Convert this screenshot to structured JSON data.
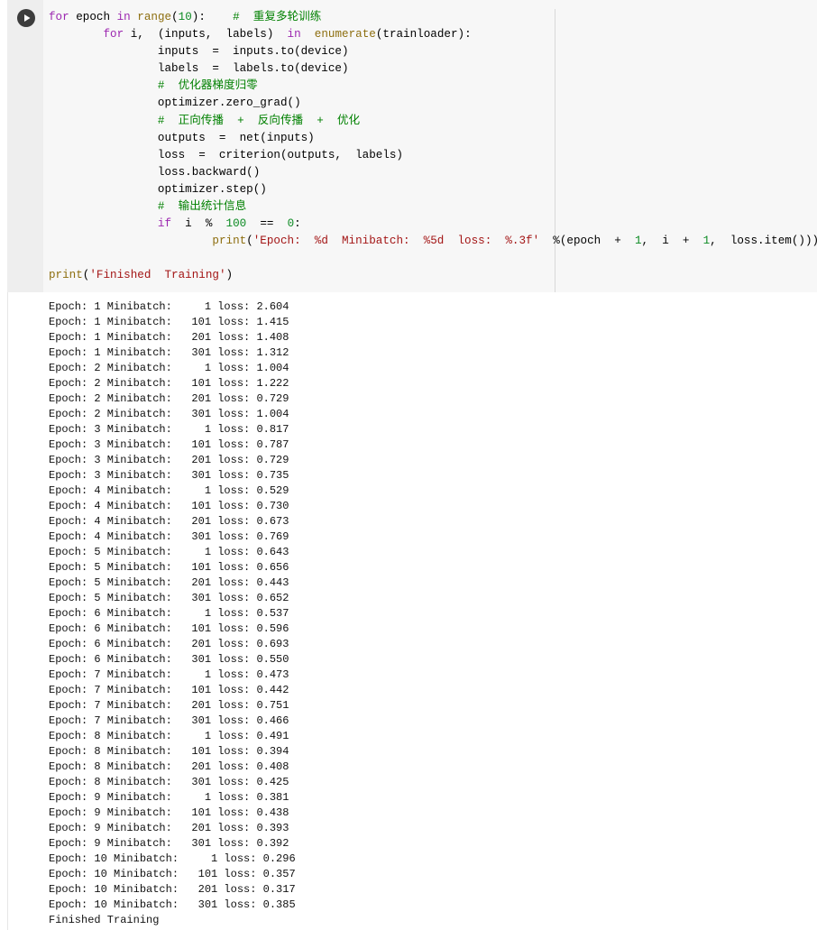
{
  "code_lines": [
    [
      {
        "t": "for",
        "c": "kw"
      },
      {
        "t": " epoch "
      },
      {
        "t": "in",
        "c": "kw"
      },
      {
        "t": " "
      },
      {
        "t": "range",
        "c": "fn"
      },
      {
        "t": "("
      },
      {
        "t": "10",
        "c": "num"
      },
      {
        "t": "):    "
      },
      {
        "t": "#  重复多轮训练",
        "c": "cm"
      }
    ],
    [
      {
        "t": "        "
      },
      {
        "t": "for",
        "c": "kw"
      },
      {
        "t": " i,  (inputs,  labels)  "
      },
      {
        "t": "in",
        "c": "kw"
      },
      {
        "t": "  "
      },
      {
        "t": "enumerate",
        "c": "fn"
      },
      {
        "t": "(trainloader):"
      }
    ],
    [
      {
        "t": "                inputs  =  inputs.to(device)"
      }
    ],
    [
      {
        "t": "                labels  =  labels.to(device)"
      }
    ],
    [
      {
        "t": "                "
      },
      {
        "t": "#  优化器梯度归零",
        "c": "cm"
      }
    ],
    [
      {
        "t": "                optimizer.zero_grad()"
      }
    ],
    [
      {
        "t": "                "
      },
      {
        "t": "#  正向传播  +  反向传播  +  优化",
        "c": "cm"
      }
    ],
    [
      {
        "t": "                outputs  =  net(inputs)"
      }
    ],
    [
      {
        "t": "                loss  =  criterion(outputs,  labels)"
      }
    ],
    [
      {
        "t": "                loss.backward()"
      }
    ],
    [
      {
        "t": "                optimizer.step()"
      }
    ],
    [
      {
        "t": "                "
      },
      {
        "t": "#  输出统计信息",
        "c": "cm"
      }
    ],
    [
      {
        "t": "                "
      },
      {
        "t": "if",
        "c": "kw"
      },
      {
        "t": "  i  %  "
      },
      {
        "t": "100",
        "c": "num"
      },
      {
        "t": "  ==  "
      },
      {
        "t": "0",
        "c": "num"
      },
      {
        "t": ":"
      }
    ],
    [
      {
        "t": "                        "
      },
      {
        "t": "print",
        "c": "fn"
      },
      {
        "t": "("
      },
      {
        "t": "'Epoch:  %d  Minibatch:  %5d  loss:  %.3f'",
        "c": "str"
      },
      {
        "t": "  %(epoch  +  "
      },
      {
        "t": "1",
        "c": "num"
      },
      {
        "t": ",  i  +  "
      },
      {
        "t": "1",
        "c": "num"
      },
      {
        "t": ",  loss.item()))"
      }
    ],
    [
      {
        "t": ""
      }
    ],
    [
      {
        "t": "print",
        "c": "fn"
      },
      {
        "t": "("
      },
      {
        "t": "'Finished  Training'",
        "c": "str"
      },
      {
        "t": ")"
      }
    ]
  ],
  "output_lines": [
    "Epoch: 1 Minibatch:     1 loss: 2.604",
    "Epoch: 1 Minibatch:   101 loss: 1.415",
    "Epoch: 1 Minibatch:   201 loss: 1.408",
    "Epoch: 1 Minibatch:   301 loss: 1.312",
    "Epoch: 2 Minibatch:     1 loss: 1.004",
    "Epoch: 2 Minibatch:   101 loss: 1.222",
    "Epoch: 2 Minibatch:   201 loss: 0.729",
    "Epoch: 2 Minibatch:   301 loss: 1.004",
    "Epoch: 3 Minibatch:     1 loss: 0.817",
    "Epoch: 3 Minibatch:   101 loss: 0.787",
    "Epoch: 3 Minibatch:   201 loss: 0.729",
    "Epoch: 3 Minibatch:   301 loss: 0.735",
    "Epoch: 4 Minibatch:     1 loss: 0.529",
    "Epoch: 4 Minibatch:   101 loss: 0.730",
    "Epoch: 4 Minibatch:   201 loss: 0.673",
    "Epoch: 4 Minibatch:   301 loss: 0.769",
    "Epoch: 5 Minibatch:     1 loss: 0.643",
    "Epoch: 5 Minibatch:   101 loss: 0.656",
    "Epoch: 5 Minibatch:   201 loss: 0.443",
    "Epoch: 5 Minibatch:   301 loss: 0.652",
    "Epoch: 6 Minibatch:     1 loss: 0.537",
    "Epoch: 6 Minibatch:   101 loss: 0.596",
    "Epoch: 6 Minibatch:   201 loss: 0.693",
    "Epoch: 6 Minibatch:   301 loss: 0.550",
    "Epoch: 7 Minibatch:     1 loss: 0.473",
    "Epoch: 7 Minibatch:   101 loss: 0.442",
    "Epoch: 7 Minibatch:   201 loss: 0.751",
    "Epoch: 7 Minibatch:   301 loss: 0.466",
    "Epoch: 8 Minibatch:     1 loss: 0.491",
    "Epoch: 8 Minibatch:   101 loss: 0.394",
    "Epoch: 8 Minibatch:   201 loss: 0.408",
    "Epoch: 8 Minibatch:   301 loss: 0.425",
    "Epoch: 9 Minibatch:     1 loss: 0.381",
    "Epoch: 9 Minibatch:   101 loss: 0.438",
    "Epoch: 9 Minibatch:   201 loss: 0.393",
    "Epoch: 9 Minibatch:   301 loss: 0.392",
    "Epoch: 10 Minibatch:     1 loss: 0.296",
    "Epoch: 10 Minibatch:   101 loss: 0.357",
    "Epoch: 10 Minibatch:   201 loss: 0.317",
    "Epoch: 10 Minibatch:   301 loss: 0.385",
    "Finished Training"
  ],
  "icons": {
    "run": "play-circle-icon"
  },
  "colors": {
    "keyword": "#9c27b0",
    "builtin": "#8d6e0f",
    "number": "#0b8a22",
    "string": "#a31515",
    "comment": "#008000"
  }
}
